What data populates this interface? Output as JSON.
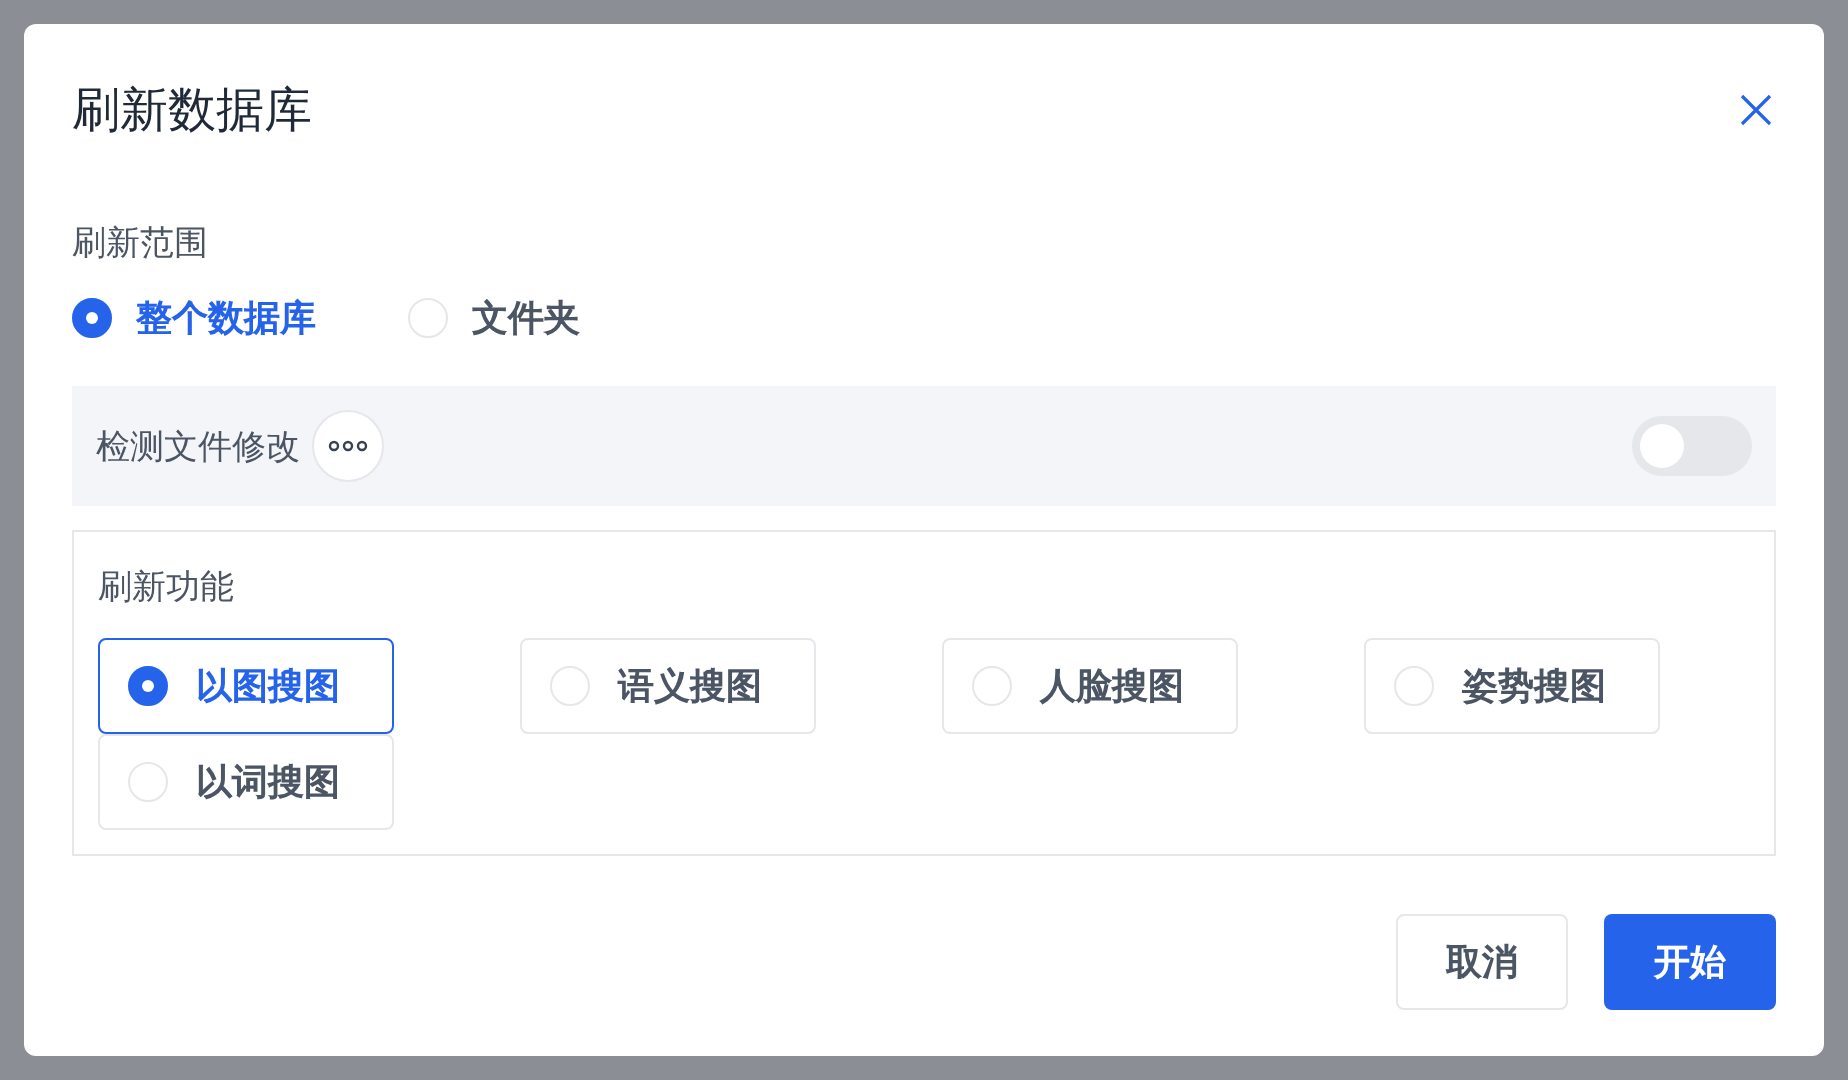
{
  "dialog": {
    "title": "刷新数据库"
  },
  "scope": {
    "label": "刷新范围",
    "options": [
      {
        "label": "整个数据库",
        "selected": true
      },
      {
        "label": "文件夹",
        "selected": false
      }
    ]
  },
  "detect_changes": {
    "label": "检测文件修改",
    "on": false
  },
  "features": {
    "label": "刷新功能",
    "options": [
      {
        "label": "以图搜图",
        "selected": true
      },
      {
        "label": "语义搜图",
        "selected": false
      },
      {
        "label": "人脸搜图",
        "selected": false
      },
      {
        "label": "姿势搜图",
        "selected": false
      },
      {
        "label": "以词搜图",
        "selected": false
      }
    ]
  },
  "buttons": {
    "cancel": "取消",
    "start": "开始"
  }
}
